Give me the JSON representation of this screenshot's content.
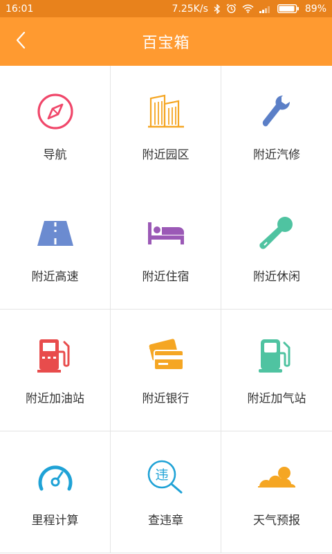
{
  "status_bar": {
    "time": "16:01",
    "speed": "7.25K/s",
    "battery": "89%",
    "icons": [
      "bluetooth-icon",
      "alarm-icon",
      "wifi-icon",
      "signal-icon",
      "battery-icon"
    ]
  },
  "header": {
    "title": "百宝箱",
    "back_icon": "chevron-left-icon"
  },
  "colors": {
    "status_bar": "#e8821c",
    "header": "#ff9a30",
    "divider": "#e4e4e4",
    "text": "#333333"
  },
  "grid": {
    "items": [
      {
        "label": "导航",
        "icon": "compass-icon",
        "color": "#f0476a"
      },
      {
        "label": "附近园区",
        "icon": "buildings-icon",
        "color": "#f5a623"
      },
      {
        "label": "附近汽修",
        "icon": "wrench-icon",
        "color": "#5b7fc7"
      },
      {
        "label": "附近高速",
        "icon": "highway-icon",
        "color": "#6b8bd0"
      },
      {
        "label": "附近住宿",
        "icon": "bed-icon",
        "color": "#9b59b6"
      },
      {
        "label": "附近休闲",
        "icon": "microphone-icon",
        "color": "#4fc3a1"
      },
      {
        "label": "附近加油站",
        "icon": "gas-station-icon",
        "color": "#e84c4c"
      },
      {
        "label": "附近银行",
        "icon": "bank-cards-icon",
        "color": "#f5a623"
      },
      {
        "label": "附近加气站",
        "icon": "gas-pump-icon",
        "color": "#4fc3a1"
      },
      {
        "label": "里程计算",
        "icon": "speedometer-icon",
        "color": "#1fa2d6"
      },
      {
        "label": "查违章",
        "icon": "violation-search-icon",
        "color": "#1fa2d6"
      },
      {
        "label": "天气预报",
        "icon": "weather-cloud-icon",
        "color": "#f5a623"
      }
    ]
  }
}
